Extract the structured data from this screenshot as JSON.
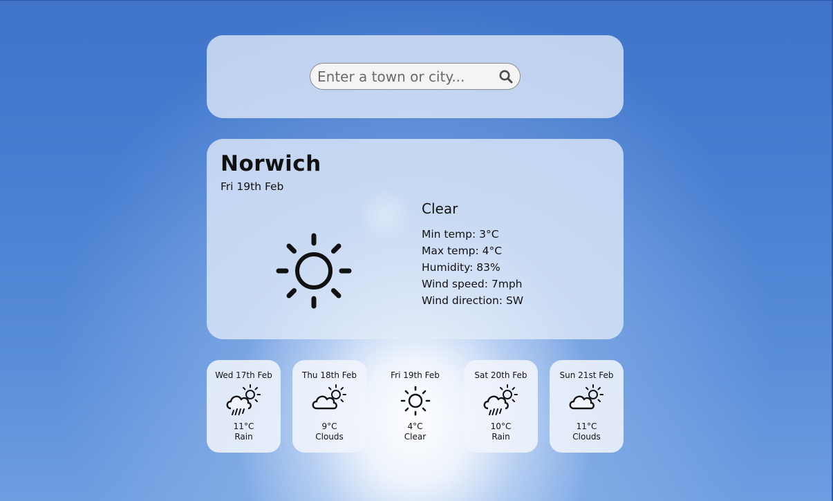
{
  "search": {
    "placeholder": "Enter a town or city...",
    "value": ""
  },
  "current": {
    "city": "Norwich",
    "date": "Fri 19th Feb",
    "condition": "Clear",
    "icon": "sun-icon",
    "details": [
      "Min temp: 3°C",
      "Max temp: 4°C",
      "Humidity: 83%",
      "Wind speed: 7mph",
      "Wind direction: SW"
    ]
  },
  "forecast": [
    {
      "day": "Wed 17th Feb",
      "temp": "11°C",
      "desc": "Rain",
      "icon": "rain-icon"
    },
    {
      "day": "Thu 18th Feb",
      "temp": "9°C",
      "desc": "Clouds",
      "icon": "partly-cloudy-icon"
    },
    {
      "day": "Fri 19th Feb",
      "temp": "4°C",
      "desc": "Clear",
      "icon": "sun-icon"
    },
    {
      "day": "Sat 20th Feb",
      "temp": "10°C",
      "desc": "Rain",
      "icon": "rain-icon"
    },
    {
      "day": "Sun 21st Feb",
      "temp": "11°C",
      "desc": "Clouds",
      "icon": "partly-cloudy-icon"
    }
  ]
}
